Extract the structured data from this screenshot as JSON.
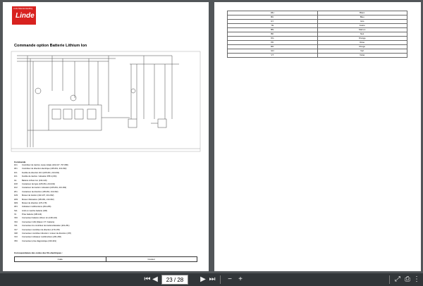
{
  "viewer": {
    "page_field": "23 / 28"
  },
  "left_page": {
    "logo_tagline": "Linde Material Handling",
    "logo_name": "Linde",
    "title": "Commande option Batterie Lithium Ion",
    "legend_title": "Commande",
    "legend": [
      {
        "code": "1K1",
        "desc": "Contrôleur de traction, levée initiale (102-107, 707-080)"
      },
      {
        "code": "3K1",
        "desc": "Contrôleur de direction électrique (105-061, 213-032)"
      },
      {
        "code": "1F1",
        "desc": "Fusible de direction 40 A (105-061, 213-032)"
      },
      {
        "code": "1F1",
        "desc": "Fusible de traction / élévation 355 A (154)"
      },
      {
        "code": "G1",
        "desc": "Batterie Lithium Ion (134-149)"
      },
      {
        "code": "1K8",
        "desc": "Contacteur de ligne (105-061, 213-032)"
      },
      {
        "code": "1K2",
        "desc": "Contacteur de traction / élévation (105-061, 213-032)"
      },
      {
        "code": "2K1",
        "desc": "Contacteur de direction (105-061, 213-032)"
      },
      {
        "code": "1M1",
        "desc": "Moteur de traction (102-107, 213-032)"
      },
      {
        "code": "2M1",
        "desc": "Moteur d'élévation (105-061, 213-032)"
      },
      {
        "code": "3M1",
        "desc": "Moteur de direction (170-178)"
      },
      {
        "code": "4P4",
        "desc": "Indicateur multifonctions (261-266)"
      },
      {
        "code": "S11",
        "desc": "Arrêt en marche batterie (106)"
      },
      {
        "code": "X1",
        "desc": "Prise batterie (138-144)"
      },
      {
        "code": "X33",
        "desc": "Connecteur batterie Lithium Ion (138-143)"
      },
      {
        "code": "X34",
        "desc": "Connecteur CAN (Datum CT / batterie)"
      },
      {
        "code": "X11",
        "desc": "Connecteur du contrôleur de traction/élévation (201-251)"
      },
      {
        "code": "X17",
        "desc": "Connecteur contrôleur de direction (170-178)"
      },
      {
        "code": "X48",
        "desc": "Connecteur contrôleur direction / moteur de direction (178)"
      },
      {
        "code": "X13",
        "desc": "Connecteur indicateur multifonctions (261-266)"
      },
      {
        "code": "X53",
        "desc": "Connecteur prise diagnostique (316-319)"
      }
    ],
    "correspondence_title": "Correspondance des codes des fils électriques :",
    "correspondence_headers": [
      "Code",
      "Couleur"
    ]
  },
  "right_page": {
    "color_codes": [
      {
        "code": "WH",
        "color": "Blanc"
      },
      {
        "code": "BU",
        "color": "Bleu"
      },
      {
        "code": "GY",
        "color": "Gris"
      },
      {
        "code": "YE",
        "color": "Jaune"
      },
      {
        "code": "BN",
        "color": "Marron"
      },
      {
        "code": "BK",
        "color": "Noir"
      },
      {
        "code": "OG",
        "color": "Orange"
      },
      {
        "code": "PK",
        "color": "Rose"
      },
      {
        "code": "RD",
        "color": "Rouge"
      },
      {
        "code": "GN",
        "color": "Vert"
      },
      {
        "code": "VT",
        "color": "Violet"
      }
    ]
  },
  "colors": {
    "viewer_background": "#525659",
    "toolbar": "#323639",
    "logo_red": "#d8221f"
  },
  "icons": [
    "first-page-icon",
    "prev-page-icon",
    "next-page-icon",
    "last-page-icon",
    "zoom-out-icon",
    "zoom-in-icon",
    "fit-page-icon",
    "print-icon",
    "more-icon"
  ]
}
